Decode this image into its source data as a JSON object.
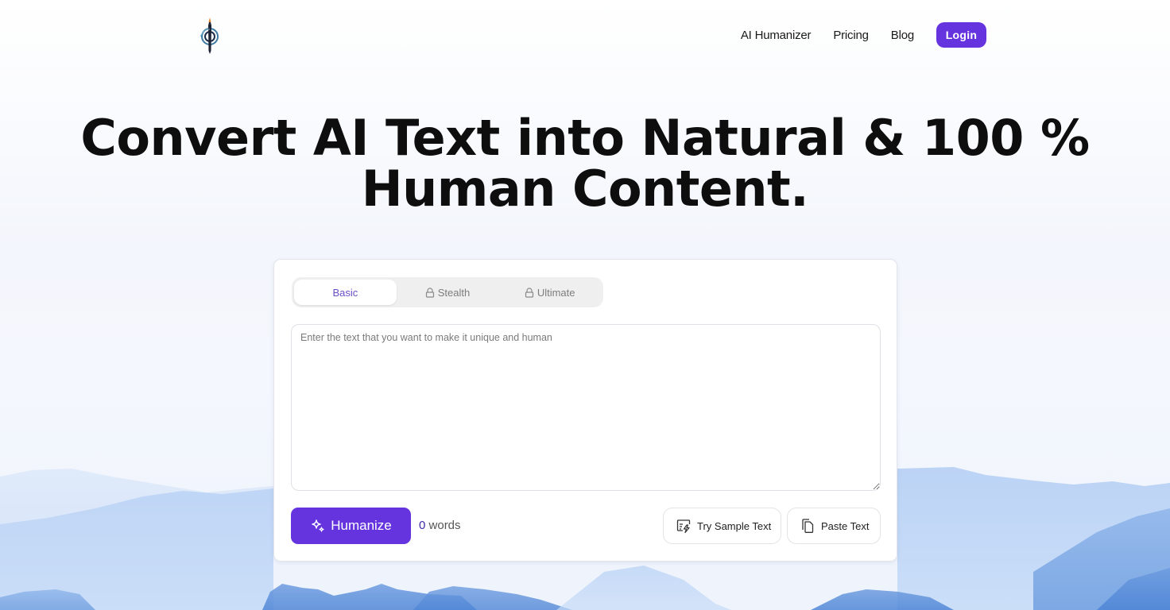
{
  "header": {
    "logo_icon": "pen-compass-logo",
    "nav": [
      {
        "label": "AI Humanizer"
      },
      {
        "label": "Pricing"
      },
      {
        "label": "Blog"
      }
    ],
    "login_label": "Login"
  },
  "hero": {
    "line1": "Convert AI Text into Natural & 100 %",
    "line2": "Human Content."
  },
  "editor": {
    "tabs": [
      {
        "label": "Basic",
        "active": true,
        "locked": false
      },
      {
        "label": "Stealth",
        "active": false,
        "locked": true,
        "icon": "lock-icon"
      },
      {
        "label": "Ultimate",
        "active": false,
        "locked": true,
        "icon": "lock-icon"
      }
    ],
    "input_value": "",
    "input_placeholder": "Enter the text that you want to make it unique and human",
    "humanize_label": "Humanize",
    "humanize_icon": "sparkles-icon",
    "word_count": "0",
    "word_count_suffix": "words",
    "try_sample_label": "Try Sample Text",
    "try_sample_icon": "sample-text-icon",
    "paste_label": "Paste Text",
    "paste_icon": "copy-icon"
  },
  "colors": {
    "accent": "#6534df",
    "active_tab_text": "#6a4ec4",
    "mountain_light": "#c6dbf7",
    "mountain_dark": "#5b8fd8"
  }
}
